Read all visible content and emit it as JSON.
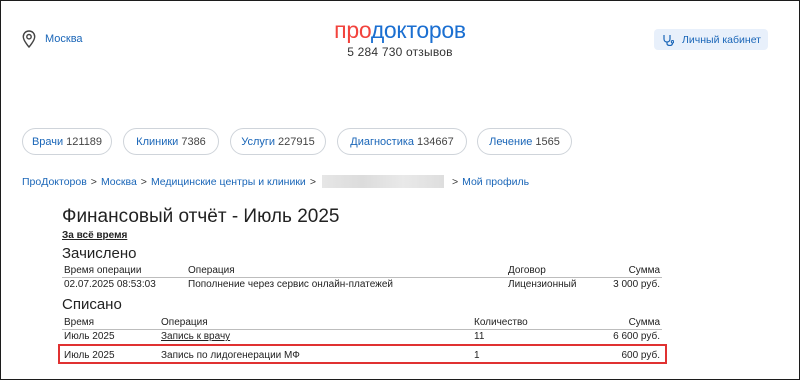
{
  "header": {
    "city": "Москва",
    "logo_left": "про",
    "logo_right": "докторов",
    "reviews": "5 284 730 отзывов",
    "cabinet_label": "Личный кабинет"
  },
  "nav": [
    {
      "label": "Врачи",
      "count": "121189"
    },
    {
      "label": "Клиники",
      "count": "7386"
    },
    {
      "label": "Услуги",
      "count": "227915"
    },
    {
      "label": "Диагностика",
      "count": "134667"
    },
    {
      "label": "Лечение",
      "count": "1565"
    }
  ],
  "breadcrumbs": {
    "items": [
      "ПроДокторов",
      "Москва",
      "Медицинские центры и клиники"
    ],
    "sep": ">",
    "last": "Мой профиль"
  },
  "report": {
    "title": "Финансовый отчёт - Июль 2025",
    "period_link": "За всё время",
    "credited": {
      "heading": "Зачислено",
      "columns": [
        "Время операции",
        "Операция",
        "Договор",
        "Сумма"
      ],
      "rows": [
        [
          "02.07.2025 08:53:03",
          "Пополнение через сервис онлайн-платежей",
          "Лицензионный",
          "3 000 руб."
        ]
      ]
    },
    "debited": {
      "heading": "Списано",
      "columns": [
        "Время",
        "Операция",
        "Количество",
        "Сумма"
      ],
      "rows": [
        [
          "Июль 2025",
          "Запись к врачу",
          "11",
          "6 600 руб."
        ],
        [
          "Июль 2025",
          "Запись по лидогенерации МФ",
          "1",
          "600 руб."
        ]
      ]
    }
  },
  "colors": {
    "brand_red": "#f2433d",
    "brand_blue": "#1b6fd1",
    "link": "#1a66b8",
    "highlight": "#e03131"
  }
}
